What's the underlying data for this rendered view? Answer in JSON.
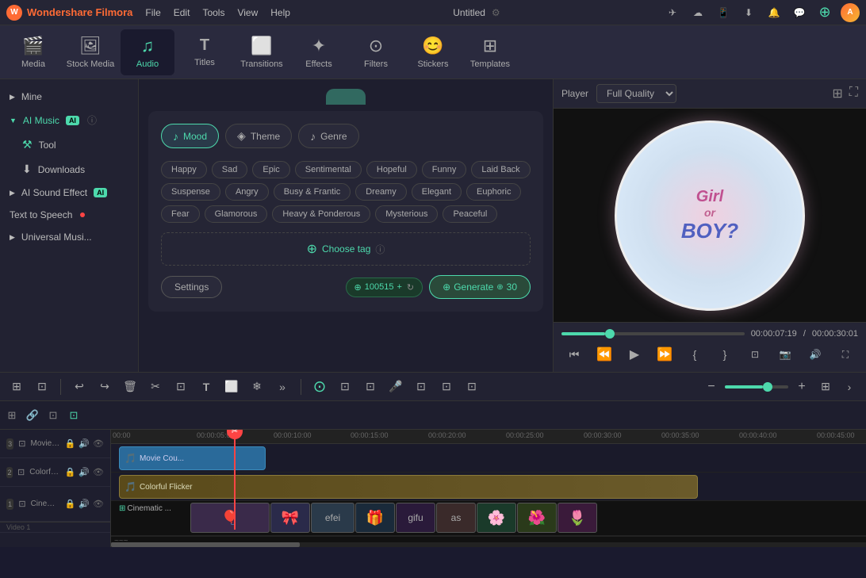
{
  "app": {
    "name": "Wondershare Filmora",
    "title": "Untitled"
  },
  "menu": {
    "items": [
      "File",
      "Edit",
      "Tools",
      "View",
      "Help"
    ]
  },
  "toolbar": {
    "items": [
      {
        "id": "media",
        "label": "Media",
        "icon": "🎬"
      },
      {
        "id": "stock-media",
        "label": "Stock Media",
        "icon": "🖼"
      },
      {
        "id": "audio",
        "label": "Audio",
        "icon": "🎵"
      },
      {
        "id": "titles",
        "label": "Titles",
        "icon": "T"
      },
      {
        "id": "transitions",
        "label": "Transitions",
        "icon": "⬜"
      },
      {
        "id": "effects",
        "label": "Effects",
        "icon": "✦"
      },
      {
        "id": "filters",
        "label": "Filters",
        "icon": "⊙"
      },
      {
        "id": "stickers",
        "label": "Stickers",
        "icon": "😊"
      },
      {
        "id": "templates",
        "label": "Templates",
        "icon": "⬚"
      }
    ],
    "active": "audio"
  },
  "sidebar": {
    "items": [
      {
        "id": "mine",
        "label": "Mine",
        "expanded": false,
        "arrow": "▶"
      },
      {
        "id": "ai-music",
        "label": "AI Music",
        "expanded": true,
        "badge": "AI",
        "hasInfo": true,
        "arrow": "▼"
      },
      {
        "id": "tool",
        "label": "Tool",
        "indent": true
      },
      {
        "id": "downloads",
        "label": "Downloads",
        "indent": true
      },
      {
        "id": "ai-sound-effect",
        "label": "AI Sound Effect",
        "badge": "AI",
        "expanded": false
      },
      {
        "id": "text-to-speech",
        "label": "Text to Speech",
        "hasDot": true
      },
      {
        "id": "universal-music",
        "label": "Universal Musi...",
        "expanded": false
      }
    ]
  },
  "ai_music_panel": {
    "tabs": [
      {
        "id": "mood",
        "label": "Mood",
        "icon": "♪",
        "active": true
      },
      {
        "id": "theme",
        "label": "Theme",
        "icon": "♦"
      },
      {
        "id": "genre",
        "label": "Genre",
        "icon": "♪"
      }
    ],
    "mood_tags": [
      {
        "label": "Happy",
        "selected": false
      },
      {
        "label": "Sad",
        "selected": false
      },
      {
        "label": "Epic",
        "selected": false
      },
      {
        "label": "Sentimental",
        "selected": false
      },
      {
        "label": "Hopeful",
        "selected": false
      },
      {
        "label": "Funny",
        "selected": false
      },
      {
        "label": "Laid Back",
        "selected": false
      },
      {
        "label": "Suspense",
        "selected": false
      },
      {
        "label": "Angry",
        "selected": false
      },
      {
        "label": "Busy & Frantic",
        "selected": false
      },
      {
        "label": "Dreamy",
        "selected": false
      },
      {
        "label": "Elegant",
        "selected": false
      },
      {
        "label": "Euphoric",
        "selected": false
      },
      {
        "label": "Fear",
        "selected": false
      },
      {
        "label": "Glamorous",
        "selected": false
      },
      {
        "label": "Heavy & Ponderous",
        "selected": false
      },
      {
        "label": "Mysterious",
        "selected": false
      },
      {
        "label": "Peaceful",
        "selected": false
      }
    ],
    "choose_tag_label": "Choose tag",
    "settings_label": "Settings",
    "credits": "100515",
    "generate_label": "Generate",
    "generate_cost": "30"
  },
  "player": {
    "label": "Player",
    "quality": "Full Quality",
    "current_time": "00:00:07:19",
    "total_time": "00:00:30:01",
    "progress_pct": 24
  },
  "timeline": {
    "tracks": [
      {
        "num": "3",
        "label": "Movie Cou...",
        "type": "audio",
        "clip_color": "blue"
      },
      {
        "num": "2",
        "label": "Colorful Flicker",
        "type": "audio",
        "clip_color": "gold"
      },
      {
        "num": "1",
        "label": "Cinematic ...",
        "type": "video",
        "clip_color": "mixed"
      }
    ],
    "track_label": "Video 1",
    "rulers": [
      "00:00",
      "00:00:05:00",
      "00:00:10:00",
      "00:00:15:00",
      "00:00:20:00",
      "00:00:25:00",
      "00:00:30:00",
      "00:00:35:00",
      "00:00:40:00",
      "00:00:45:00"
    ]
  }
}
